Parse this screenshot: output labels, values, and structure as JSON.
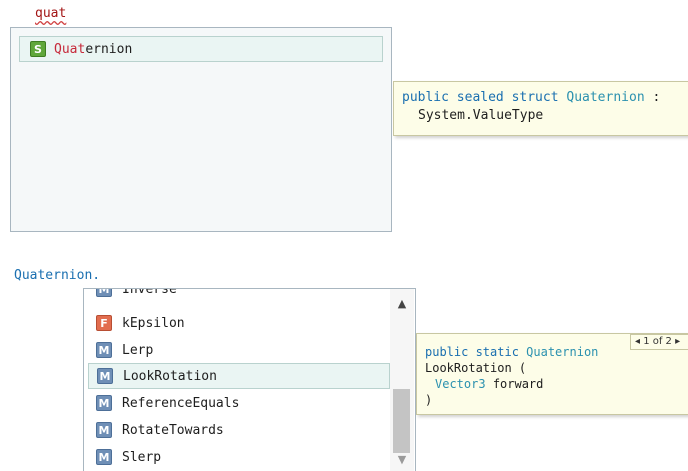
{
  "top": {
    "typed": "quat",
    "item": {
      "badge": "S",
      "match": "Quat",
      "rest": "ernion"
    },
    "tooltip": {
      "kw1": "public sealed struct",
      "name": "Quaternion",
      "colon": ":",
      "base": "System.ValueType"
    }
  },
  "bottom": {
    "typed": "Quaternion.",
    "items": [
      {
        "badge": "M",
        "label": "Inverse"
      },
      {
        "badge": "F",
        "label": "kEpsilon"
      },
      {
        "badge": "M",
        "label": "Lerp"
      },
      {
        "badge": "M",
        "label": "LookRotation"
      },
      {
        "badge": "M",
        "label": "ReferenceEquals"
      },
      {
        "badge": "M",
        "label": "RotateTowards"
      },
      {
        "badge": "M",
        "label": "Slerp"
      }
    ],
    "selected_label": "LookRotation",
    "scroll_up": "▲",
    "scroll_down": "▼",
    "tooltip": {
      "kw": "public static",
      "ret": "Quaternion",
      "method": "LookRotation (",
      "param_type": "Vector3",
      "param_name": "forward",
      "close": ")",
      "overload": "◂ 1 of 2 ▸"
    }
  },
  "colors": {
    "keyword": "#1a6fb0",
    "type": "#2b91af",
    "match": "#c6293a",
    "badge_struct": "#5fa73a",
    "badge_method": "#6f8fb6",
    "badge_field": "#e26d4f",
    "tooltip_bg": "#fdfde8",
    "selection_bg": "#eaf5f3"
  }
}
